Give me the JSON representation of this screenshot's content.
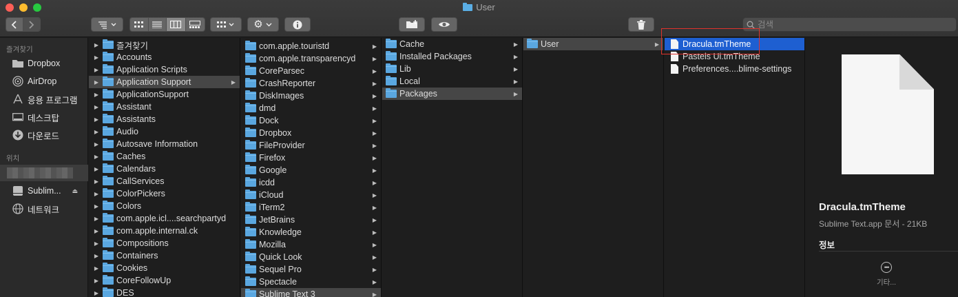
{
  "window": {
    "title": "User"
  },
  "toolbar": {
    "search_placeholder": "검색"
  },
  "sidebar": {
    "favorites_header": "즐겨찾기",
    "favorites": [
      {
        "label": "Dropbox",
        "icon": "dropbox-folder-icon"
      },
      {
        "label": "AirDrop",
        "icon": "airdrop-icon"
      },
      {
        "label": "응용 프로그램",
        "icon": "applications-icon"
      },
      {
        "label": "데스크탑",
        "icon": "desktop-icon"
      },
      {
        "label": "다운로드",
        "icon": "downloads-icon"
      }
    ],
    "locations_header": "위치",
    "locations": [
      {
        "label": "Sublim...",
        "icon": "disk-icon"
      },
      {
        "label": "네트워크",
        "icon": "network-icon"
      }
    ]
  },
  "columns": {
    "col1": [
      "즐겨찾기",
      "Accounts",
      "Application Scripts",
      "Application Support",
      "ApplicationSupport",
      "Assistant",
      "Assistants",
      "Audio",
      "Autosave Information",
      "Caches",
      "Calendars",
      "CallServices",
      "ColorPickers",
      "Colors",
      "com.apple.icl....searchpartyd",
      "com.apple.internal.ck",
      "Compositions",
      "Containers",
      "Cookies",
      "CoreFollowUp",
      "DES"
    ],
    "col2": [
      "com.apple.touristd",
      "com.apple.transparencyd",
      "CoreParsec",
      "CrashReporter",
      "DiskImages",
      "dmd",
      "Dock",
      "Dropbox",
      "FileProvider",
      "Firefox",
      "Google",
      "icdd",
      "iCloud",
      "iTerm2",
      "JetBrains",
      "Knowledge",
      "Mozilla",
      "Quick Look",
      "Sequel Pro",
      "Spectacle",
      "Sublime Text 3"
    ],
    "col3": [
      "Cache",
      "Installed Packages",
      "Lib",
      "Local",
      "Packages"
    ],
    "col4": [
      "User"
    ],
    "col5": [
      "Dracula.tmTheme",
      "Pastels Ui.tmTheme",
      "Preferences....blime-settings"
    ]
  },
  "preview": {
    "name": "Dracula.tmTheme",
    "subtitle": "Sublime Text.app 문서 - 21KB",
    "info_header": "정보",
    "more_label": "기타..."
  }
}
